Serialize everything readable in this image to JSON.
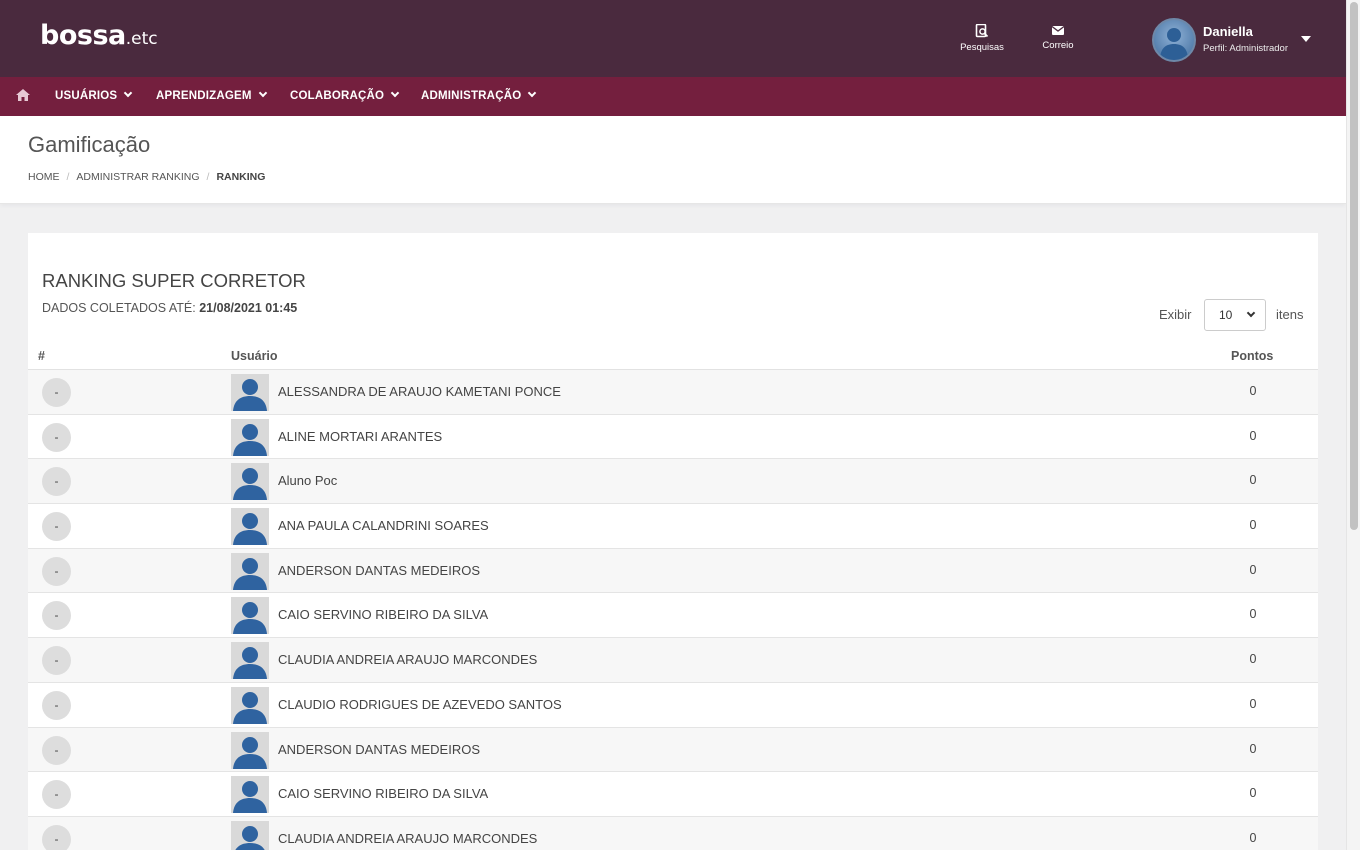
{
  "header": {
    "logo_text": "bossa",
    "logo_suffix": ".etc",
    "actions": [
      {
        "label": "Pesquisas",
        "icon": "search-document-icon"
      },
      {
        "label": "Correio",
        "icon": "envelope-icon"
      }
    ],
    "user": {
      "name": "Daniella",
      "role": "Perfil: Administrador"
    }
  },
  "nav": {
    "home_icon": "home-icon",
    "items": [
      {
        "label": "USUÁRIOS"
      },
      {
        "label": "APRENDIZAGEM"
      },
      {
        "label": "COLABORAÇÃO"
      },
      {
        "label": "ADMINISTRAÇÃO"
      }
    ]
  },
  "page": {
    "title": "Gamificação",
    "breadcrumb": [
      "HOME",
      "ADMINISTRAR RANKING",
      "RANKING"
    ]
  },
  "ranking": {
    "title": "RANKING SUPER CORRETOR",
    "collected_label": "DADOS COLETADOS ATÉ:",
    "collected_value": "21/08/2021 01:45",
    "show_label": "Exibir",
    "show_value": "10",
    "items_label": "itens",
    "columns": [
      "#",
      "Usuário",
      "Pontos"
    ],
    "rows": [
      {
        "rank": "-",
        "name": "ALESSANDRA DE ARAUJO KAMETANI PONCE",
        "points": "0"
      },
      {
        "rank": "-",
        "name": "ALINE MORTARI ARANTES",
        "points": "0"
      },
      {
        "rank": "-",
        "name": "Aluno Poc",
        "points": "0"
      },
      {
        "rank": "-",
        "name": "ANA PAULA CALANDRINI SOARES",
        "points": "0"
      },
      {
        "rank": "-",
        "name": "ANDERSON DANTAS MEDEIROS",
        "points": "0"
      },
      {
        "rank": "-",
        "name": "CAIO SERVINO RIBEIRO DA SILVA",
        "points": "0"
      },
      {
        "rank": "-",
        "name": "CLAUDIA ANDREIA ARAUJO MARCONDES",
        "points": "0"
      },
      {
        "rank": "-",
        "name": "CLAUDIO RODRIGUES DE AZEVEDO SANTOS",
        "points": "0"
      },
      {
        "rank": "-",
        "name": "ANDERSON DANTAS MEDEIROS",
        "points": "0"
      },
      {
        "rank": "-",
        "name": "CAIO SERVINO RIBEIRO DA SILVA",
        "points": "0"
      },
      {
        "rank": "-",
        "name": "CLAUDIA ANDREIA ARAUJO MARCONDES",
        "points": "0"
      }
    ]
  },
  "colors": {
    "header_bg": "#4a2a3e",
    "nav_bg": "#741f3e",
    "avatar_blue": "#2f63a0"
  }
}
